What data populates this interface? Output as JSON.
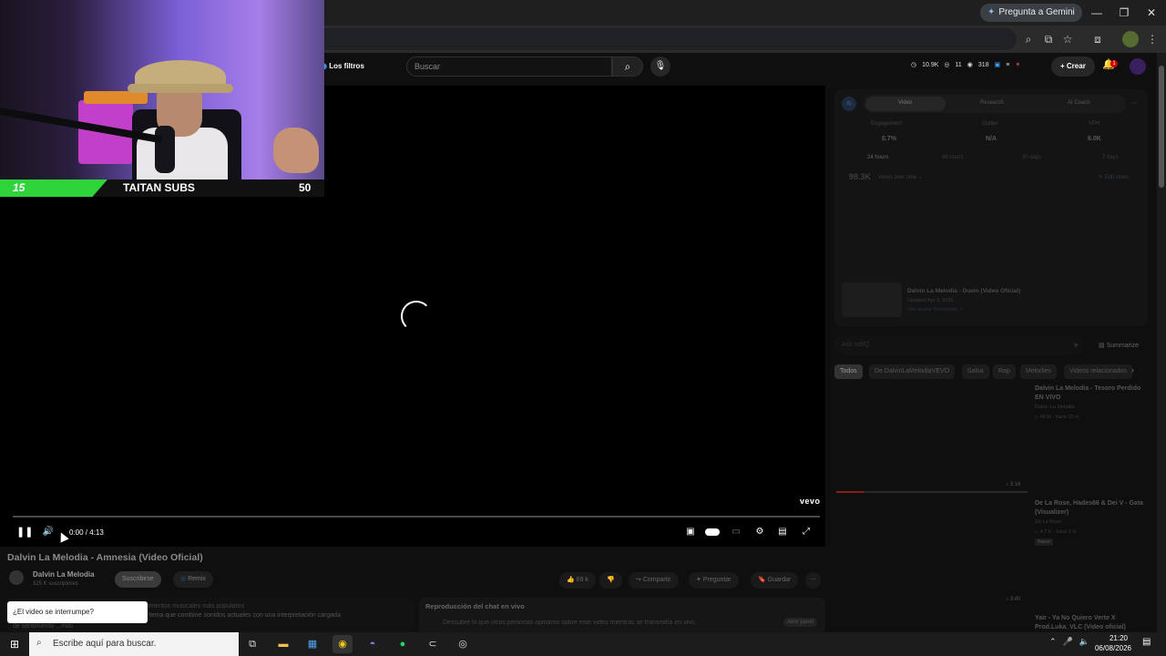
{
  "browser": {
    "gemini_label": "Pregunta a Gemini",
    "window_buttons": [
      "—",
      "❐",
      "✕"
    ]
  },
  "youtube": {
    "filters_label": "Los filtros",
    "search_placeholder": "Buscar",
    "stats": [
      "10.9K",
      "11",
      "318"
    ],
    "create_label": "Crear",
    "notification_count": "1"
  },
  "player": {
    "time": "0:00 / 4:13",
    "watermark": "vevo"
  },
  "webcam": {
    "subs_current": "15",
    "subs_label": "TAITAN SUBS",
    "subs_goal": "50"
  },
  "video": {
    "title": "Dalvin La Melodia - Amnesia (Video Oficial)",
    "channel": "Dalvin La Melodia",
    "subscribers": "325 K suscriptores",
    "subscribe_label": "Suscribirse",
    "remix_label": "Remix",
    "likes": "69 k",
    "share_label": "Compartir",
    "ask_label": "Preguntar",
    "save_label": "Guardar",
    "desc_line1": "Mostrar los momentos musicales más populares",
    "desc_line2": "\"Amnesia\": un tema que combine sonidos actuales con una interpretación cargada",
    "desc_more": "de sentimiento ...más",
    "toast": "¿El video se interrumpe?",
    "chat_title": "Reproducción del chat en vivo",
    "chat_desc": "Descubre lo que otras personas opinaron sobre este video mientras se transmitía en vivo.",
    "chat_open": "Abrir panel"
  },
  "vidiq": {
    "logo": "IQ",
    "tabs": [
      "Video",
      "Research",
      "AI Coach"
    ],
    "metrics": [
      {
        "label": "Engagement",
        "value": "0.7%"
      },
      {
        "label": "Outlier",
        "value": "N/A"
      },
      {
        "label": "VPH",
        "value": "6.0K"
      }
    ],
    "ranges": [
      "24 hours",
      "48 hours",
      "30 days",
      "7 days"
    ],
    "views": "98.3K",
    "views_over": "Views over time ⌄",
    "edit_video": "✎ Edit video",
    "related_title": "Dalvin La Melodia - Duelo (Video Oficial)",
    "related_date": "Updated Apr 9, 2025",
    "related_link": "See similar thumbnails ↗",
    "ask_placeholder": "Ask vidIQ",
    "summarize": "Summarize"
  },
  "chips": [
    "Todos",
    "De DalvinLaMelodiaVEVO",
    "Salsa",
    "Rap",
    "Melodies",
    "Videos relacionados"
  ],
  "recommendations": [
    {
      "title": "Dalvin La Melodia - Tesoro Perdido EN VIVO",
      "channel": "Dalvin La Melodia",
      "meta": "▷ 48 M · hace 10 m",
      "duration": "3:16"
    },
    {
      "title": "De La Rose, Hades66 & Dei V - Gata (Visualizer)",
      "channel": "De La Rose",
      "meta": "▷ 4.7 K · hace 1 h",
      "badge": "Nuevo",
      "duration": "3:40"
    },
    {
      "title": "Yair - Ya No Quiero Verte  X Prod.Luka_VLC (Video oficial)",
      "channel": "",
      "meta": "",
      "duration": ""
    }
  ],
  "taskbar": {
    "search_placeholder": "Escribe aquí para buscar.",
    "time": "21:20",
    "date": "06/08/2026"
  },
  "colors": {
    "accent_green": "#2ed43a",
    "youtube_red": "#cc0000",
    "background": "#0f0f0f"
  }
}
